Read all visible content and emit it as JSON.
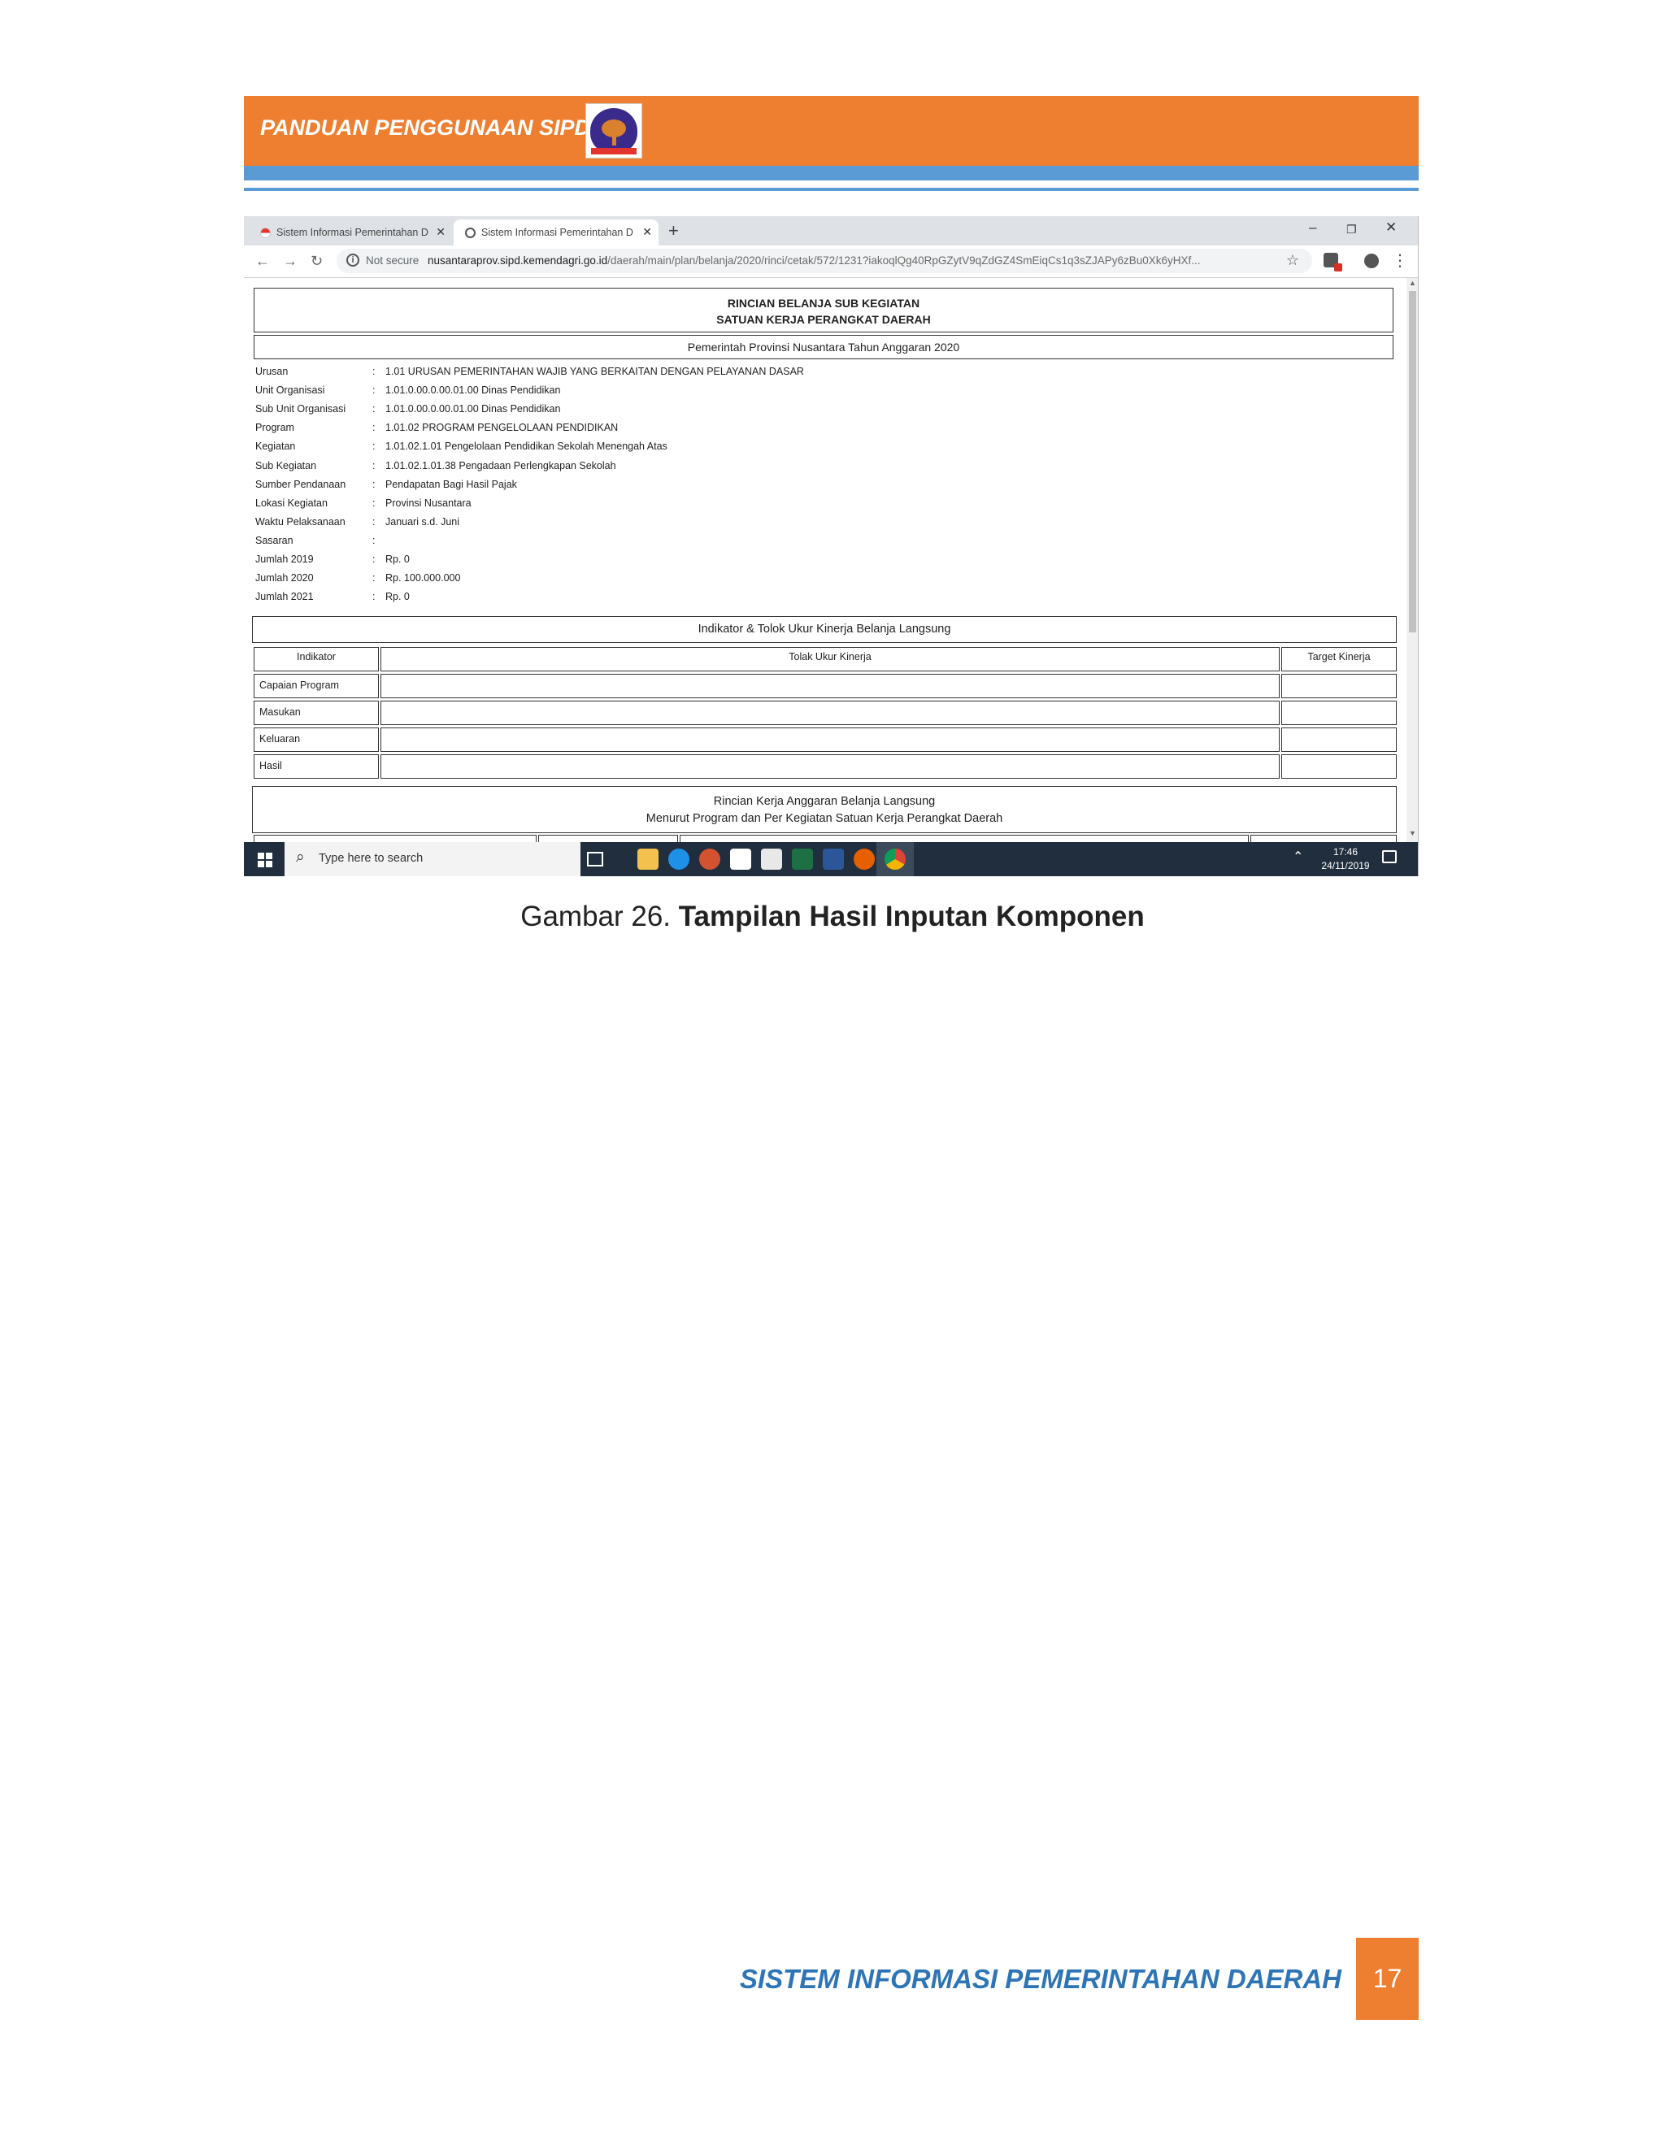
{
  "doc": {
    "header_title": "PANDUAN PENGGUNAAN SIPD",
    "caption_prefix": "Gambar 26.",
    "caption_bold": "Tampilan Hasil Inputan Komponen",
    "footer_title": "SISTEM INFORMASI PEMERINTAHAN DAERAH",
    "page_number": "17"
  },
  "browser": {
    "tabs": [
      {
        "label": "Sistem Informasi Pemerintahan D"
      },
      {
        "label": "Sistem Informasi Pemerintahan D"
      }
    ],
    "not_secure": "Not secure",
    "url_host": "nusantaraprov.sipd.kemendagri.go.id",
    "url_path": "/daerah/main/plan/belanja/2020/rinci/cetak/572/1231?iakoqlQg40RpGZytV9qZdGZ4SmEiqCs1q3sZJAPy6zBu0Xk6yHXf..."
  },
  "report": {
    "title_line1": "RINCIAN BELANJA SUB KEGIATAN",
    "title_line2": "SATUAN KERJA PERANGKAT DAERAH",
    "subtitle": "Pemerintah Provinsi Nusantara Tahun Anggaran 2020",
    "info": [
      {
        "label": "Urusan",
        "value": "1.01 URUSAN PEMERINTAHAN WAJIB YANG BERKAITAN DENGAN PELAYANAN DASAR"
      },
      {
        "label": "Unit Organisasi",
        "value": "1.01.0.00.0.00.01.00 Dinas Pendidikan"
      },
      {
        "label": "Sub Unit Organisasi",
        "value": "1.01.0.00.0.00.01.00 Dinas Pendidikan"
      },
      {
        "label": "Program",
        "value": "1.01.02 PROGRAM PENGELOLAAN PENDIDIKAN"
      },
      {
        "label": "Kegiatan",
        "value": "1.01.02.1.01 Pengelolaan Pendidikan Sekolah Menengah Atas"
      },
      {
        "label": "Sub Kegiatan",
        "value": "1.01.02.1.01.38  Pengadaan Perlengkapan Sekolah"
      },
      {
        "label": "Sumber Pendanaan",
        "value": "Pendapatan Bagi Hasil Pajak"
      },
      {
        "label": "Lokasi Kegiatan",
        "value": "Provinsi Nusantara"
      },
      {
        "label": "Waktu Pelaksanaan",
        "value": "Januari s.d. Juni"
      },
      {
        "label": "Sasaran",
        "value": ""
      },
      {
        "label": "Jumlah 2019",
        "value": "Rp. 0"
      },
      {
        "label": "Jumlah 2020",
        "value": "Rp. 100.000.000"
      },
      {
        "label": "Jumlah 2021",
        "value": "Rp. 0"
      }
    ],
    "indicator_header": "Indikator & Tolok Ukur Kinerja Belanja Langsung",
    "indicator_columns": [
      "Indikator",
      "Tolak Ukur Kinerja",
      "Target Kinerja"
    ],
    "indicator_rows": [
      "Capaian Program",
      "Masukan",
      "Keluaran",
      "Hasil"
    ],
    "rk_line1": "Rincian Kerja Anggaran Belanja Langsung",
    "rk_line2": "Menurut Program dan Per Kegiatan Satuan Kerja Perangkat Daerah"
  },
  "taskbar": {
    "search_placeholder": "Type here to search",
    "time": "17:46",
    "date": "24/11/2019"
  }
}
